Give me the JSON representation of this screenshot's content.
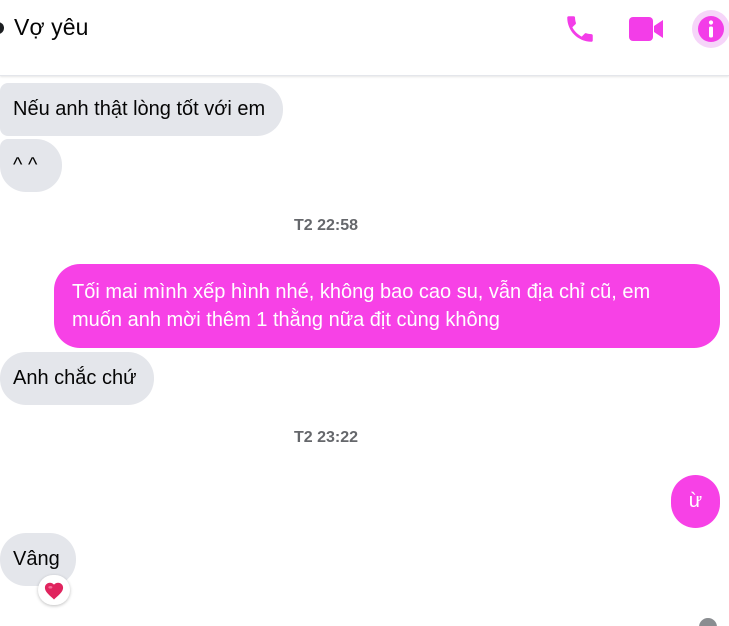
{
  "header": {
    "title": "Vợ yêu",
    "icons": [
      "phone-icon",
      "video-call-icon",
      "info-icon"
    ],
    "accent_color": "#f33de8"
  },
  "messages": [
    {
      "sender": "them",
      "text": "Nếu anh thật lòng tốt với em"
    },
    {
      "sender": "them",
      "text": "^ ^"
    },
    {
      "type": "timestamp",
      "text": "T2 22:58"
    },
    {
      "sender": "me",
      "text": "Tối mai mình xếp hình nhé, không bao cao su, vẫn địa chỉ cũ, em muốn anh mời thêm 1 thằng nữa địt cùng không"
    },
    {
      "sender": "them",
      "text": "Anh chắc chứ"
    },
    {
      "type": "timestamp",
      "text": "T2 23:22"
    },
    {
      "sender": "me",
      "text": "ừ"
    },
    {
      "sender": "them",
      "text": "Vâng",
      "reaction": "heart-icon"
    }
  ],
  "colors": {
    "incoming_bubble": "#e4e6eb",
    "outgoing_bubble": "#f741e6",
    "timestamp_text": "#65676b"
  }
}
